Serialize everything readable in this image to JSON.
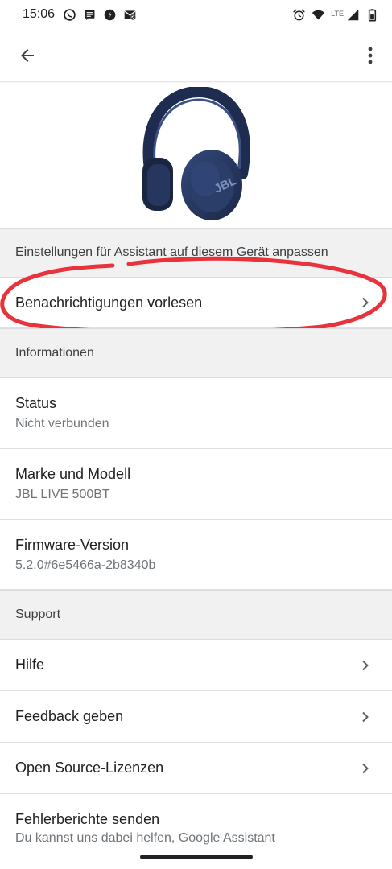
{
  "status_bar": {
    "time": "15:06",
    "network": "LTE",
    "left_icons": [
      "whatsapp-icon",
      "message-icon",
      "shazam-icon",
      "mail-blocked-icon"
    ],
    "right_icons": [
      "alarm-icon",
      "wifi-icon",
      "signal-icon",
      "battery-icon"
    ]
  },
  "app_bar": {
    "back_icon": "arrow-back-icon",
    "menu_icon": "more-vert-icon"
  },
  "device": {
    "image": "headphones-image"
  },
  "sections": {
    "assistant": "Einstellungen für Assistant auf diesem Gerät anpassen",
    "info": "Informationen",
    "support": "Support"
  },
  "rows": {
    "notifications": {
      "title": "Benachrichtigungen vorlesen"
    },
    "status": {
      "title": "Status",
      "value": "Nicht verbunden"
    },
    "model": {
      "title": "Marke und Modell",
      "value": "JBL LIVE 500BT"
    },
    "firmware": {
      "title": "Firmware-Version",
      "value": "5.2.0#6e5466a-2b8340b"
    },
    "help": {
      "title": "Hilfe"
    },
    "feedback": {
      "title": "Feedback geben"
    },
    "licenses": {
      "title": "Open Source-Lizenzen"
    },
    "bug_report": {
      "title": "Fehlerberichte senden",
      "value": "Du kannst uns dabei helfen, Google Assistant"
    }
  },
  "colors": {
    "annotation": "#e8323c",
    "section_bg": "#f1f1f1",
    "headphone": "#23355f"
  }
}
